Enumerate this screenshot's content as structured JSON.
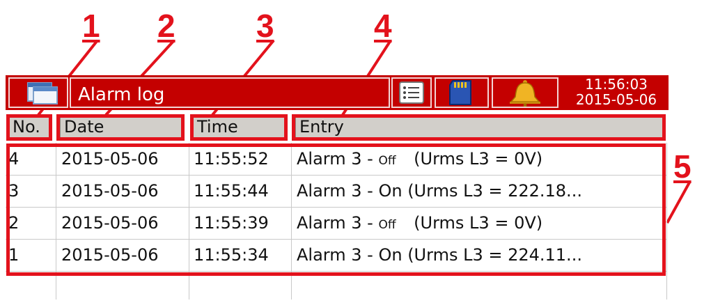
{
  "callouts": [
    "1",
    "2",
    "3",
    "4",
    "5"
  ],
  "titlebar": {
    "window_icon": "window-icon",
    "title": "Alarm log",
    "list_icon": "list-icon",
    "sd_card_icon": "sd-card-icon",
    "bell_icon": "bell-icon",
    "time": "11:56:03",
    "date": "2015-05-06"
  },
  "columns": [
    "No.",
    "Date",
    "Time",
    "Entry"
  ],
  "rows": [
    {
      "no": "4",
      "date": "2015-05-06",
      "time": "11:55:52",
      "entry_prefix": "Alarm 3 - ",
      "state": "Off",
      "detail": "(Urms L3 = 0V)"
    },
    {
      "no": "3",
      "date": "2015-05-06",
      "time": "11:55:44",
      "entry_prefix": "Alarm 3 - ",
      "state": "On",
      "detail": "(Urms L3 = 222.18..."
    },
    {
      "no": "2",
      "date": "2015-05-06",
      "time": "11:55:39",
      "entry_prefix": "Alarm 3 - ",
      "state": "Off",
      "detail": "(Urms L3 = 0V)"
    },
    {
      "no": "1",
      "date": "2015-05-06",
      "time": "11:55:34",
      "entry_prefix": "Alarm 3 - ",
      "state": "On",
      "detail": "(Urms L3 = 224.11..."
    }
  ],
  "colors": {
    "titlebar": "#c40000",
    "header": "#d2cfca",
    "callout": "#e3121c"
  }
}
